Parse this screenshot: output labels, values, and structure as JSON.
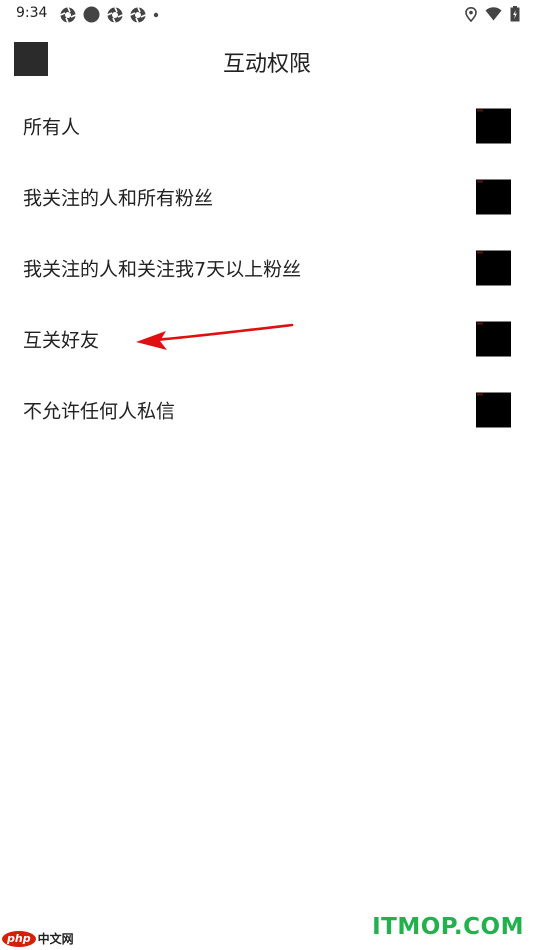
{
  "status_bar": {
    "time": "9:34",
    "left_icons": [
      "aperture-icon",
      "circle-icon",
      "aperture-icon",
      "aperture-icon",
      "dot-icon"
    ],
    "right_icons": [
      "location-icon",
      "wifi-icon",
      "battery-icon"
    ]
  },
  "header": {
    "title": "互动权限",
    "back_icon": "back-icon"
  },
  "options": [
    {
      "label": "所有人"
    },
    {
      "label": "我关注的人和所有粉丝"
    },
    {
      "label": "我关注的人和关注我7天以上粉丝"
    },
    {
      "label": "互关好友"
    },
    {
      "label": "不允许任何人私信"
    }
  ],
  "annotation": {
    "color": "#e01010",
    "target": "互关好友"
  },
  "watermarks": {
    "left_logo": "php",
    "left_text": "中文网",
    "right_text": "ITMOP.COM"
  },
  "colors": {
    "background": "#ffffff",
    "text": "#222222",
    "radio": "#000000",
    "watermark_green": "#22b14c",
    "watermark_red": "#d81e06"
  }
}
